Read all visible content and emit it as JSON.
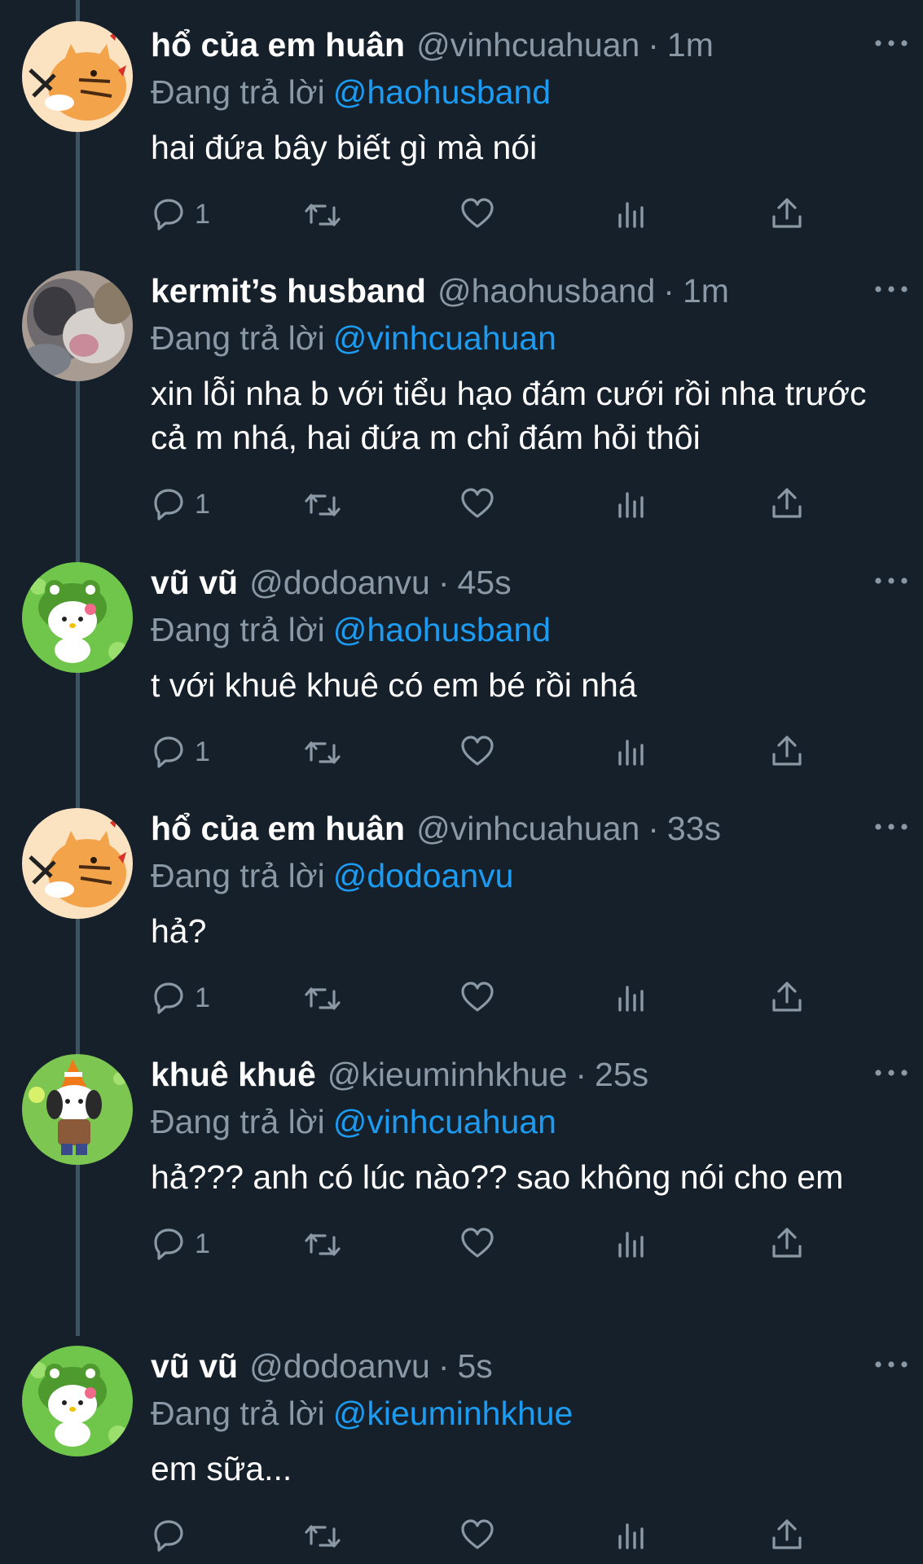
{
  "reply_prefix": "Đang trả lời",
  "tweets": [
    {
      "name": "hổ của em huân",
      "handle": "@vinhcuahuan",
      "sep": "·",
      "time": "1m",
      "reply_to": "@haohusband",
      "text": "hai đứa bây biết gì mà nói",
      "reply_count": "1",
      "avatar_icon": "orange-cat-icon"
    },
    {
      "name": "kermit’s husband",
      "handle": "@haohusband",
      "sep": "·",
      "time": "1m",
      "reply_to": "@vinhcuahuan",
      "text": "xin lỗi nha b với tiểu hạo đám cưới rồi nha trước cả m nhá, hai đứa m chỉ đám hỏi thôi",
      "reply_count": "1",
      "avatar_icon": "blurry-photo-icon"
    },
    {
      "name": "vũ vũ",
      "handle": "@dodoanvu",
      "sep": "·",
      "time": "45s",
      "reply_to": "@haohusband",
      "text": "t với khuê khuê có em bé rồi nhá",
      "reply_count": "1",
      "avatar_icon": "hello-kitty-frog-icon"
    },
    {
      "name": "hổ của em huân",
      "handle": "@vinhcuahuan",
      "sep": "·",
      "time": "33s",
      "reply_to": "@dodoanvu",
      "text": "hả?",
      "reply_count": "1",
      "avatar_icon": "orange-cat-icon"
    },
    {
      "name": "khuê khuê",
      "handle": "@kieuminhkhue",
      "sep": "·",
      "time": "25s",
      "reply_to": "@vinhcuahuan",
      "text": "hả??? anh có lúc nào?? sao không nói cho em",
      "reply_count": "1",
      "avatar_icon": "pochacco-cone-icon"
    },
    {
      "name": "vũ vũ",
      "handle": "@dodoanvu",
      "sep": "·",
      "time": "5s",
      "reply_to": "@kieuminhkhue",
      "text": "em sữa...",
      "reply_count": "",
      "avatar_icon": "hello-kitty-frog-icon"
    }
  ],
  "colors": {
    "background": "#15202b",
    "text_secondary": "#8b98a5",
    "mention": "#1d9bf0",
    "thread_line": "#3d5466"
  }
}
